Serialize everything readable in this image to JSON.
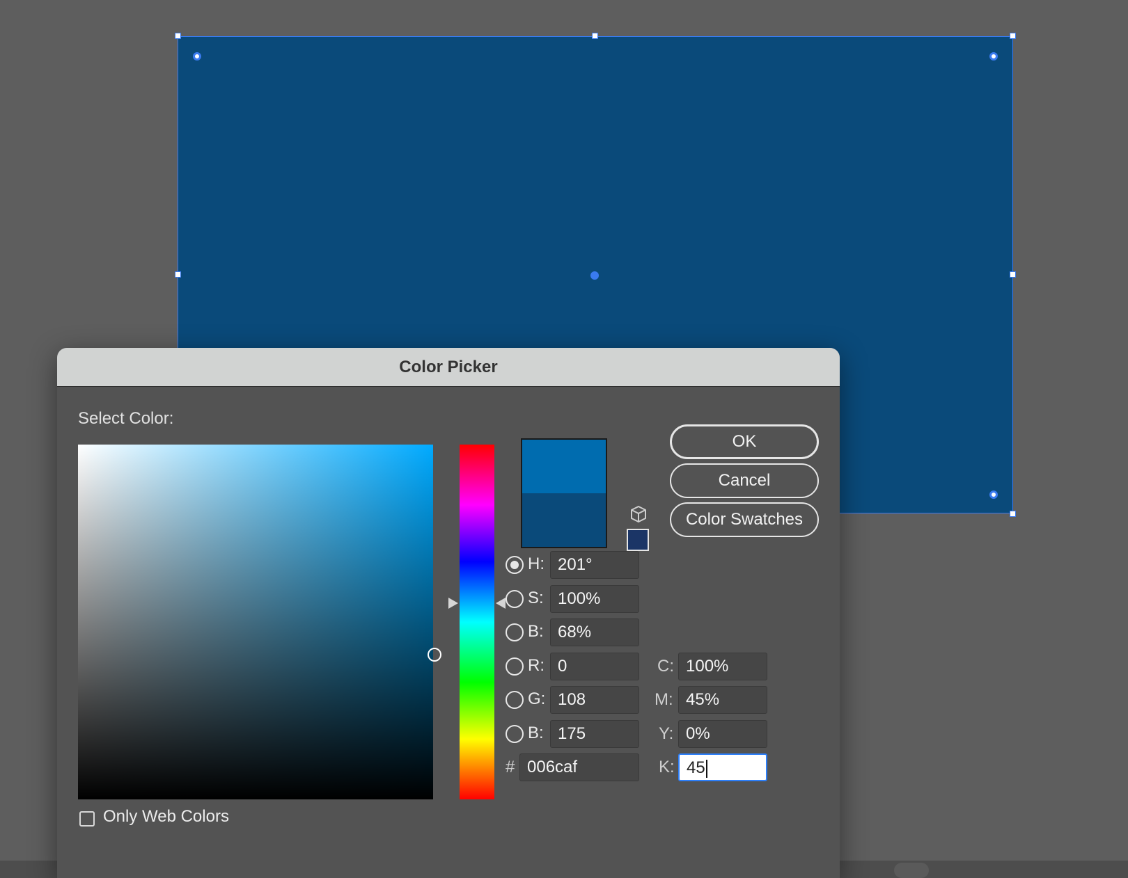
{
  "dialog": {
    "title": "Color Picker",
    "select_label": "Select Color:",
    "buttons": {
      "ok": "OK",
      "cancel": "Cancel",
      "swatches": "Color Swatches"
    },
    "preview": {
      "new_color": "#006caf",
      "current_color": "#0a4a7a"
    },
    "fields": {
      "h": {
        "label": "H:",
        "value": "201°",
        "selected": true
      },
      "s": {
        "label": "S:",
        "value": "100%"
      },
      "b": {
        "label": "B:",
        "value": "68%"
      },
      "r": {
        "label": "R:",
        "value": "0"
      },
      "g": {
        "label": "G:",
        "value": "108"
      },
      "blue": {
        "label": "B:",
        "value": "175"
      },
      "hex": {
        "label": "#",
        "value": "006caf"
      },
      "c": {
        "label": "C:",
        "value": "100%"
      },
      "m": {
        "label": "M:",
        "value": "45%"
      },
      "y": {
        "label": "Y:",
        "value": "0%"
      },
      "k": {
        "label": "K:",
        "value": "45"
      }
    },
    "only_web_colors": {
      "label": "Only Web Colors",
      "checked": false
    }
  },
  "colors": {
    "artwork_fill": "#0a4a7a",
    "selection": "#3a7bf0",
    "gamut_warning_swatch": "#1b3566"
  },
  "icons": {
    "gamut_warning": "cube-icon"
  }
}
